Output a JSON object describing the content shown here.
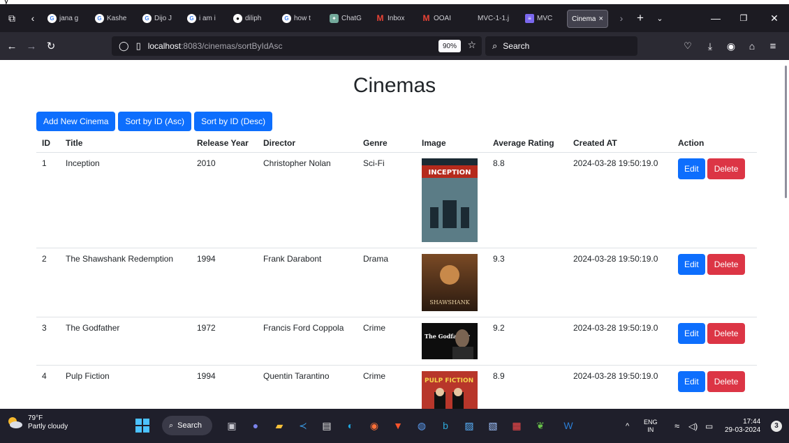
{
  "browser": {
    "tabs": [
      {
        "title": "jana g",
        "icon": "google-icon",
        "color": "#ffffff"
      },
      {
        "title": "Kashe",
        "icon": "google-icon",
        "color": "#ffffff"
      },
      {
        "title": "Dijo J",
        "icon": "google-icon",
        "color": "#ffffff"
      },
      {
        "title": "i am i",
        "icon": "google-icon",
        "color": "#ffffff"
      },
      {
        "title": "diliph",
        "icon": "github-icon",
        "color": "#ffffff"
      },
      {
        "title": "how t",
        "icon": "google-icon",
        "color": "#ffffff"
      },
      {
        "title": "ChatG",
        "icon": "chatgpt-icon",
        "color": "#74aa9c"
      },
      {
        "title": "Inbox",
        "icon": "gmail-icon",
        "color": "#ea4335"
      },
      {
        "title": "OOAI",
        "icon": "gmail-icon",
        "color": "#ea4335"
      },
      {
        "title": "MVC-1-1.j",
        "icon": "none",
        "color": ""
      },
      {
        "title": "MVC",
        "icon": "app-icon",
        "color": "#7b68ee"
      },
      {
        "title": "Cinema",
        "icon": "none",
        "color": "",
        "active": true
      }
    ],
    "close_tab": "×",
    "url_host": "localhost",
    "url_rest": ":8083/cinemas/sortByIdAsc",
    "zoom": "90%",
    "search_placeholder": "Search"
  },
  "page": {
    "title": "Cinemas",
    "buttons": {
      "add": "Add New Cinema",
      "sort_asc": "Sort by ID (Asc)",
      "sort_desc": "Sort by ID (Desc)"
    },
    "columns": [
      "ID",
      "Title",
      "Release Year",
      "Director",
      "Genre",
      "Image",
      "Average Rating",
      "Created AT",
      "Action"
    ],
    "rows": [
      {
        "id": "1",
        "title": "Inception",
        "year": "2010",
        "director": "Christopher Nolan",
        "genre": "Sci-Fi",
        "poster_text": "INCEPTION",
        "rating": "8.8",
        "created": "2024-03-28 19:50:19.0"
      },
      {
        "id": "2",
        "title": "The Shawshank Redemption",
        "year": "1994",
        "director": "Frank Darabont",
        "genre": "Drama",
        "poster_text": "SHAWSHANK",
        "rating": "9.3",
        "created": "2024-03-28 19:50:19.0"
      },
      {
        "id": "3",
        "title": "The Godfather",
        "year": "1972",
        "director": "Francis Ford Coppola",
        "genre": "Crime",
        "poster_text": "The Godfather",
        "rating": "9.2",
        "created": "2024-03-28 19:50:19.0"
      },
      {
        "id": "4",
        "title": "Pulp Fiction",
        "year": "1994",
        "director": "Quentin Tarantino",
        "genre": "Crime",
        "poster_text": "PULP FICTION",
        "rating": "8.9",
        "created": "2024-03-28 19:50:19.0"
      }
    ],
    "edit_label": "Edit",
    "delete_label": "Delete"
  },
  "taskbar": {
    "temperature": "79°F",
    "weather": "Partly cloudy",
    "search": "Search",
    "lang": "ENG",
    "region": "IN",
    "time": "17:44",
    "date": "29-03-2024",
    "notifications": "3"
  }
}
